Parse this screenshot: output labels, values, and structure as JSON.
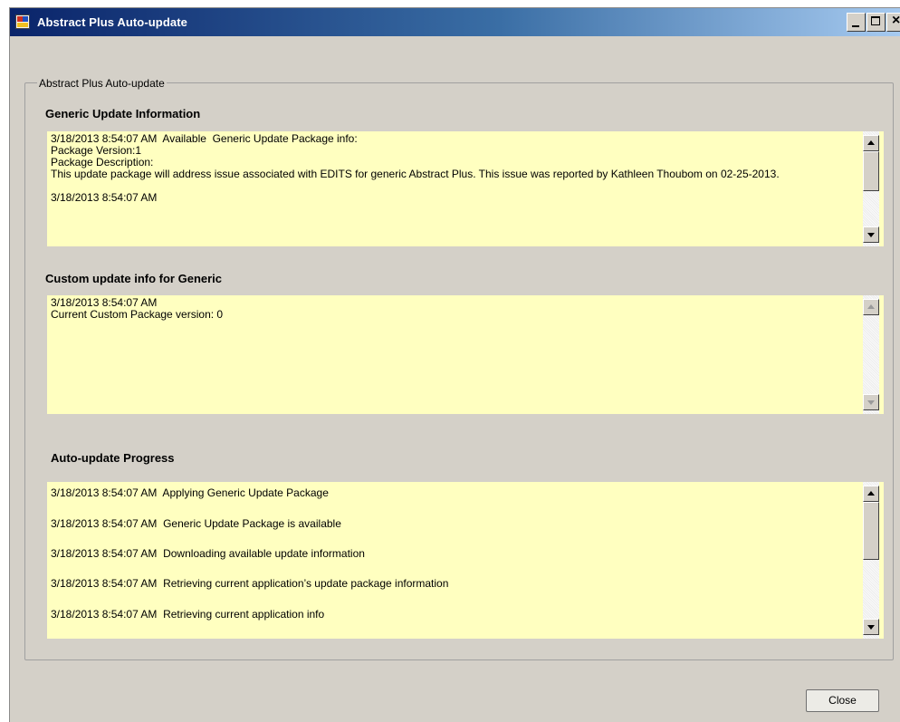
{
  "window": {
    "title": "Abstract Plus Auto-update",
    "controls": {
      "minimize": "minimize",
      "maximize": "maximize",
      "close": "×"
    }
  },
  "groupbox": {
    "label": "Abstract Plus Auto-update"
  },
  "generic_section": {
    "title": "Generic Update Information",
    "lines": [
      "3/18/2013 8:54:07 AM  Available  Generic Update Package info:",
      "Package Version:1",
      "Package Description:",
      "This update package will address issue associated with EDITS for generic Abstract Plus. This issue was reported by Kathleen Thoubom on 02-25-2013.",
      "",
      "3/18/2013 8:54:07 AM"
    ]
  },
  "custom_section": {
    "title": "Custom update info for Generic",
    "lines": [
      "3/18/2013 8:54:07 AM",
      "Current Custom Package version: 0"
    ]
  },
  "progress_section": {
    "title": "Auto-update Progress",
    "lines": [
      "3/18/2013 8:54:07 AM  Applying Generic Update Package",
      "3/18/2013 8:54:07 AM  Generic Update Package is available",
      "3/18/2013 8:54:07 AM  Downloading available update information",
      "3/18/2013 8:54:07 AM  Retrieving current application’s update package information",
      "3/18/2013 8:54:07 AM  Retrieving current application info"
    ]
  },
  "buttons": {
    "close_label": "Close"
  },
  "colors": {
    "textbox_bg": "#ffffc0",
    "window_bg": "#d4d0c8",
    "titlebar_start": "#0a246a"
  }
}
